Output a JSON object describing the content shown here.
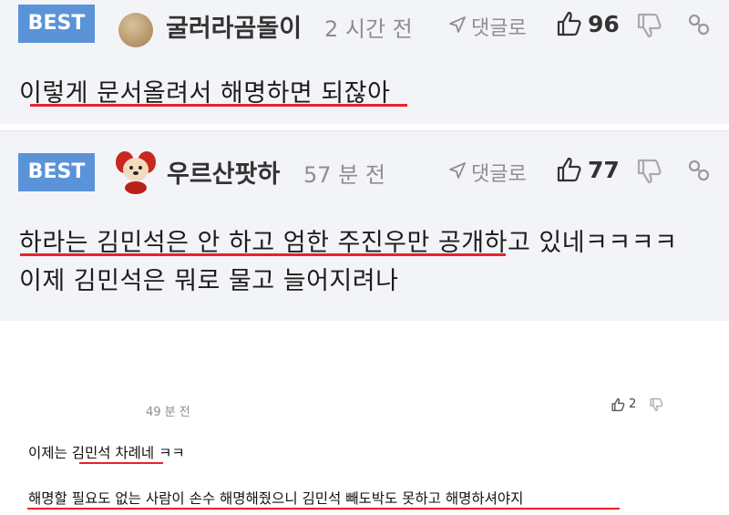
{
  "comments": [
    {
      "badge": "BEST",
      "nickname": "굴러라곰돌이",
      "time": "2 시간 전",
      "reply_label": "댓글로",
      "likes": "96",
      "lines": [
        "이렇게 문서올려서 해명하면 되잖아"
      ],
      "avatar": "bear-ball-avatar"
    },
    {
      "badge": "BEST",
      "nickname": "우르산팟하",
      "time": "57 분 전",
      "reply_label": "댓글로",
      "likes": "77",
      "lines": [
        "하라는 김민석은 안 하고 엄한 주진우만 공개하고 있네ㅋㅋㅋㅋ",
        "이제 김민석은 뭐로 물고 늘어지려나"
      ],
      "avatar": "puppy-avatar"
    },
    {
      "time": "49 분 전",
      "likes": "2",
      "lines": [
        "이제는 김민석 차례네 ㅋㅋ",
        "해명할 필요도 없는 사람이 손수 해명해줬으니 김민석 빼도박도 못하고 해명하셔야지"
      ]
    }
  ],
  "colors": {
    "badge": "#5b93d9",
    "card_bg": "#f3f4f8",
    "underline": "#e8212b",
    "muted": "#8d8d95"
  },
  "icons": [
    "reply-arrow-icon",
    "thumbs-up-icon",
    "thumbs-down-icon",
    "link-icon"
  ]
}
